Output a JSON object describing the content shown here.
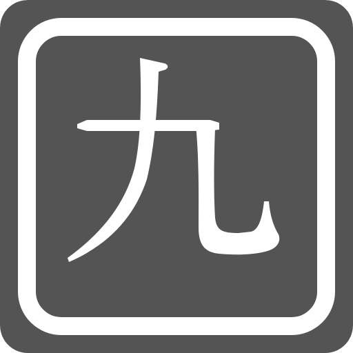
{
  "icon": {
    "character": "九",
    "semantic": "kanji-nine-icon",
    "colors": {
      "background": "#545454",
      "foreground": "#ffffff"
    }
  }
}
